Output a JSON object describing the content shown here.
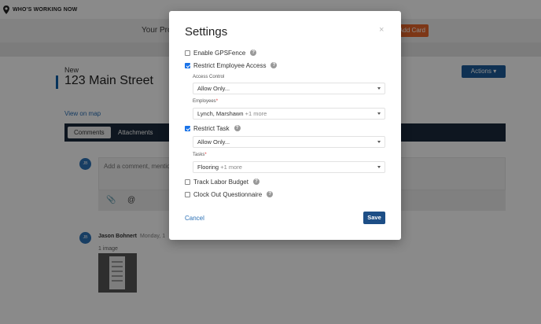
{
  "app": {
    "header_title": "WHO'S WORKING NOW"
  },
  "banner": {
    "text": "Your Pro",
    "add_card_label": "Add Card"
  },
  "job": {
    "status": "New",
    "title": "123 Main Street",
    "actions_label": "Actions ▾",
    "view_map_label": "View on map"
  },
  "tabs": [
    {
      "label": "Comments"
    },
    {
      "label": "Attachments"
    }
  ],
  "comment": {
    "avatar_initials": "JB",
    "placeholder": "Add a comment, mention"
  },
  "post": {
    "avatar_initials": "JB",
    "author": "Jason Bohnert",
    "date": "Monday, 1",
    "image_count": "1 image"
  },
  "modal": {
    "title": "Settings",
    "close_label": "×",
    "enable_gpsfence": {
      "label": "Enable GPSFence",
      "checked": false
    },
    "restrict_employee_access": {
      "label": "Restrict Employee Access",
      "checked": true
    },
    "access_control": {
      "label": "Access Control",
      "value": "Allow Only..."
    },
    "employees": {
      "label": "Employees",
      "required_mark": "*",
      "value": "Lynch, Marshawn",
      "more": "+1 more"
    },
    "restrict_task": {
      "label": "Restrict Task",
      "checked": true
    },
    "task_access": {
      "value": "Allow Only..."
    },
    "tasks": {
      "label": "Tasks",
      "required_mark": "*",
      "value": "Flooring",
      "more": "+1 more"
    },
    "track_labor_budget": {
      "label": "Track Labor Budget",
      "checked": false
    },
    "clock_out_questionnaire": {
      "label": "Clock Out Questionnaire",
      "checked": false
    },
    "help_glyph": "?",
    "cancel_label": "Cancel",
    "save_label": "Save"
  },
  "colors": {
    "primary": "#1d4e86",
    "accent": "#e8672b",
    "link": "#2a6fb5",
    "tabbar": "#1b2a3b"
  }
}
